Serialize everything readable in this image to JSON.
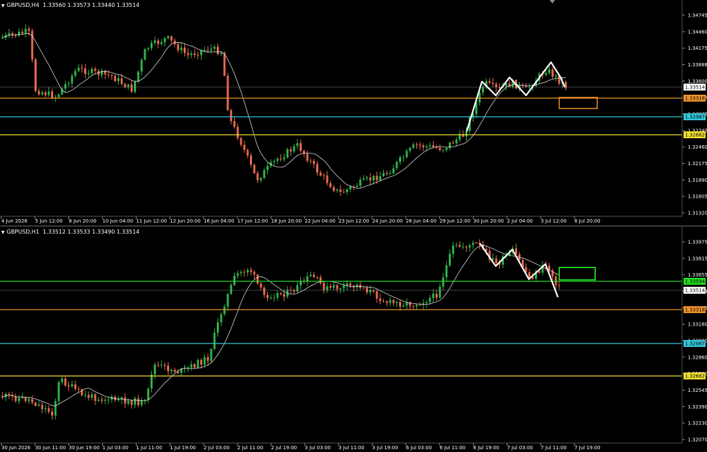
{
  "colors": {
    "bull": "#2fb34a",
    "bear": "#e8694f",
    "ma": "#d8d8d8",
    "orange": "#f0922b",
    "cyan": "#32c8d8",
    "yellow": "#f0e030",
    "green": "#22dd22",
    "grey": "#8a8a9a",
    "background": "#000000"
  },
  "top": {
    "title_symbol": "GBPUSD,H4",
    "title_ohlc": "1.33560 1.33573 1.33440 1.33514",
    "price_labels": [
      "1.34745",
      "1.34460",
      "1.34175",
      "1.33888",
      "1.33600",
      "1.33318",
      "1.33035",
      "1.32745",
      "1.32460",
      "1.32175",
      "1.31890",
      "1.31605",
      "1.31320"
    ],
    "tags": {
      "current": "1.33514",
      "orange": "1.33318",
      "cyan": "1.32987",
      "yellow": "1.32682"
    },
    "time_labels": [
      "4 Jun 2026",
      "5 Jun 12:00",
      "8 Jun 20:00",
      "10 Jun 04:00",
      "11 Jun 12:00",
      "12 Jun 20:00",
      "16 Jun 04:00",
      "17 Jun 12:00",
      "18 Jun 20:00",
      "22 Jun 04:00",
      "23 Jun 12:00",
      "24 Jun 20:00",
      "26 Jun 04:00",
      "29 Jun 12:00",
      "30 Jun 20:00",
      "2 Jul 04:00",
      "3 Jul 12:00",
      "6 Jul 20:00"
    ]
  },
  "bottom": {
    "title_symbol": "GBPUSD,H1",
    "title_ohlc": "1.33512 1.33533 1.33490 1.33514",
    "price_labels": [
      "1.33975",
      "1.33815",
      "1.33655",
      "1.33494",
      "1.33335",
      "1.33180",
      "1.33020",
      "1.32860",
      "1.32700",
      "1.32545",
      "1.32390",
      "1.32230",
      "1.32070"
    ],
    "tags": {
      "green": "1.33594",
      "current": "1.33514",
      "orange": "1.33318",
      "cyan": "1.32987",
      "yellow": "1.32682"
    },
    "time_labels": [
      "30 Jun 2026",
      "30 Jun 11:00",
      "30 Jun 19:00",
      "1 Jul 03:00",
      "1 Jul 11:00",
      "1 Jul 19:00",
      "2 Jul 03:00",
      "2 Jul 11:00",
      "2 Jul 19:00",
      "3 Jul 03:00",
      "3 Jul 11:00",
      "3 Jul 19:00",
      "6 Jul 03:00",
      "6 Jul 11:00",
      "6 Jul 19:00",
      "7 Jul 03:00",
      "7 Jul 11:00",
      "7 Jul 19:00"
    ]
  }
}
